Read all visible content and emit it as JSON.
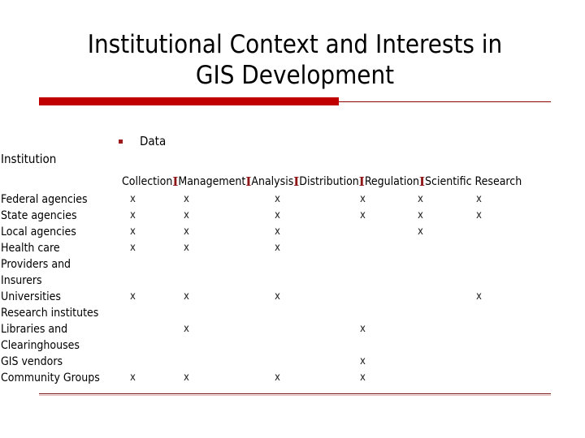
{
  "slide": {
    "title": "Institutional Context and Interests in\nGIS Development",
    "accent_color": "#c00000",
    "rule_color": "#8f0000"
  },
  "bullet": {
    "marker": "square-bullet",
    "label": "Data"
  },
  "axis_labels": {
    "row_axis": "Institution"
  },
  "matrix": {
    "column_separator": "I",
    "columns": [
      "Collection",
      "Management",
      "Analysis",
      "Distribution",
      "Regulation",
      "Scientific Research"
    ],
    "column_x": [
      160,
      226,
      338,
      443,
      514,
      586
    ],
    "mark_symbol": "x",
    "rows": [
      {
        "label": "Federal agencies",
        "marks": [
          true,
          true,
          true,
          true,
          true,
          true
        ]
      },
      {
        "label": "State agencies",
        "marks": [
          true,
          true,
          true,
          true,
          true,
          true
        ]
      },
      {
        "label": "Local agencies",
        "marks": [
          true,
          true,
          true,
          false,
          true,
          false
        ]
      },
      {
        "label": "Health care",
        "marks": [
          true,
          true,
          true,
          false,
          false,
          false
        ]
      },
      {
        "label": "Providers and",
        "marks": [
          false,
          false,
          false,
          false,
          false,
          false
        ]
      },
      {
        "label": "Insurers",
        "marks": [
          false,
          false,
          false,
          false,
          false,
          false
        ]
      },
      {
        "label": "Universities",
        "marks": [
          true,
          true,
          true,
          false,
          false,
          true
        ]
      },
      {
        "label": "Research institutes",
        "marks": [
          false,
          false,
          false,
          false,
          false,
          false
        ]
      },
      {
        "label": "Libraries and",
        "marks": [
          false,
          true,
          false,
          true,
          false,
          false
        ]
      },
      {
        "label": "Clearinghouses",
        "marks": [
          false,
          false,
          false,
          false,
          false,
          false
        ]
      },
      {
        "label": "GIS vendors",
        "marks": [
          false,
          false,
          false,
          true,
          false,
          false
        ]
      },
      {
        "label": "Community Groups",
        "marks": [
          true,
          true,
          true,
          true,
          false,
          false
        ]
      }
    ]
  },
  "chart_data": {
    "type": "table",
    "title": "Institutional Context and Interests in GIS Development",
    "xlabel": "Data",
    "ylabel": "Institution",
    "categories": [
      "Collection",
      "Management",
      "Analysis",
      "Distribution",
      "Regulation",
      "Scientific Research"
    ],
    "series": [
      {
        "name": "Federal agencies",
        "values": [
          1,
          1,
          1,
          1,
          1,
          1
        ]
      },
      {
        "name": "State agencies",
        "values": [
          1,
          1,
          1,
          1,
          1,
          1
        ]
      },
      {
        "name": "Local agencies",
        "values": [
          1,
          1,
          1,
          0,
          1,
          0
        ]
      },
      {
        "name": "Health care",
        "values": [
          1,
          1,
          1,
          0,
          0,
          0
        ]
      },
      {
        "name": "Providers and",
        "values": [
          0,
          0,
          0,
          0,
          0,
          0
        ]
      },
      {
        "name": "Insurers",
        "values": [
          0,
          0,
          0,
          0,
          0,
          0
        ]
      },
      {
        "name": "Universities",
        "values": [
          1,
          1,
          1,
          0,
          0,
          1
        ]
      },
      {
        "name": "Research institutes",
        "values": [
          0,
          0,
          0,
          0,
          0,
          0
        ]
      },
      {
        "name": "Libraries and",
        "values": [
          0,
          1,
          0,
          1,
          0,
          0
        ]
      },
      {
        "name": "Clearinghouses",
        "values": [
          0,
          0,
          0,
          0,
          0,
          0
        ]
      },
      {
        "name": "GIS vendors",
        "values": [
          0,
          0,
          0,
          1,
          0,
          0
        ]
      },
      {
        "name": "Community Groups",
        "values": [
          1,
          1,
          1,
          1,
          0,
          0
        ]
      }
    ],
    "grid": false,
    "legend": "none"
  }
}
